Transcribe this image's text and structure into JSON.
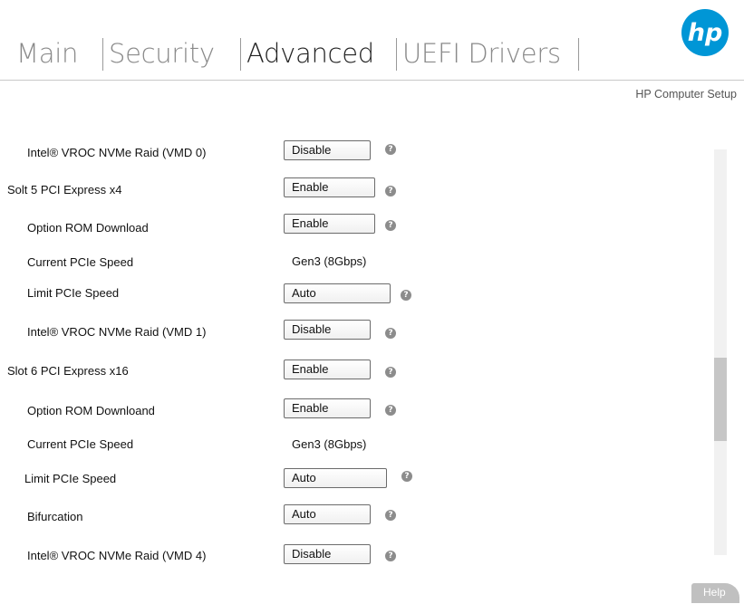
{
  "tabs": {
    "main": "Main",
    "security": "Security",
    "advanced": "Advanced",
    "uefi_drivers": "UEFI Drivers"
  },
  "header": {
    "logo_text": "hp",
    "subtitle": "HP Computer Setup"
  },
  "rows": [
    {
      "label": "Intel® VROC NVMe Raid (VMD 0)",
      "value": "Disable"
    },
    {
      "label": "Solt 5 PCI Express x4",
      "value": "Enable"
    },
    {
      "label": "Option ROM Download",
      "value": "Enable"
    },
    {
      "label": "Current PCIe Speed",
      "value": "Gen3 (8Gbps)"
    },
    {
      "label": "Limit PCIe Speed",
      "value": "Auto"
    },
    {
      "label": "Intel® VROC NVMe Raid (VMD 1)",
      "value": "Disable"
    },
    {
      "label": "Slot 6 PCI Express x16",
      "value": "Enable"
    },
    {
      "label": "Option ROM Downloand",
      "value": "Enable"
    },
    {
      "label": "Current PCIe Speed",
      "value": "Gen3 (8Gbps)"
    },
    {
      "label": "Limit PCIe Speed",
      "value": "Auto"
    },
    {
      "label": "Bifurcation",
      "value": "Auto"
    },
    {
      "label": "Intel® VROC NVMe Raid (VMD 4)",
      "value": "Disable"
    }
  ],
  "help_glyph": "?",
  "footer": {
    "help_label": "Help"
  },
  "colors": {
    "brand": "#0096d6"
  },
  "icons": {
    "logo": "hp-logo-icon",
    "help": "question-mark-icon"
  }
}
